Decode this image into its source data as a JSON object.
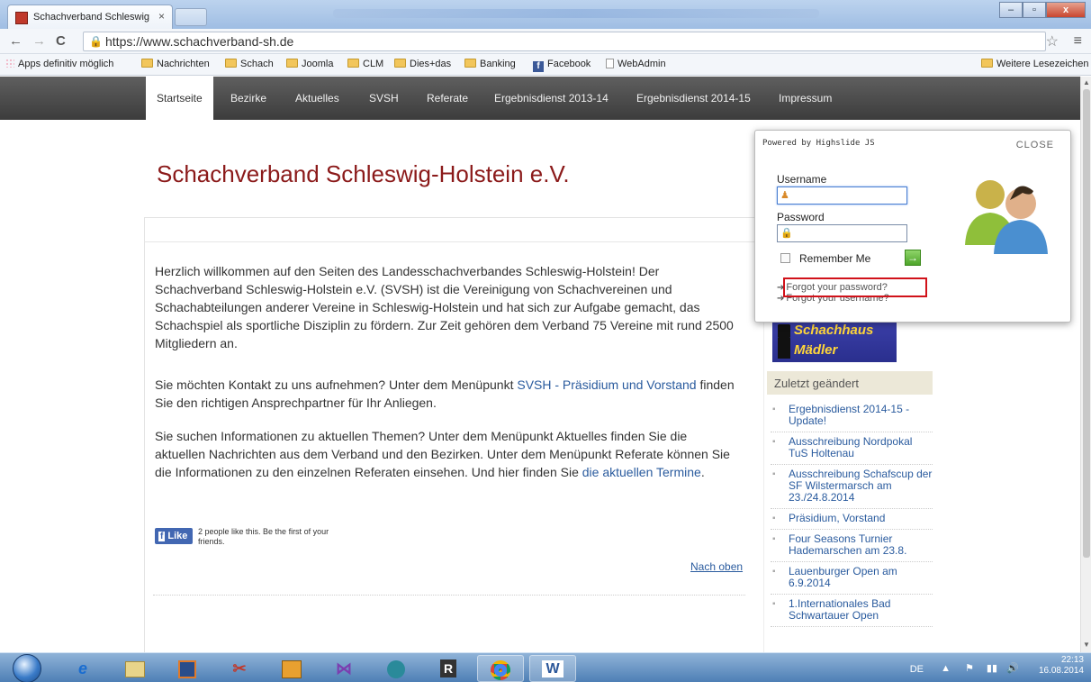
{
  "browser": {
    "tab_title": "Schachverband Schleswig",
    "tab_close": "×",
    "url": "https://www.schachverband-sh.de",
    "back": "←",
    "forward": "→",
    "reload": "C",
    "star": "☆",
    "menu": "≡"
  },
  "window": {
    "min": "–",
    "max": "▫",
    "close": "x"
  },
  "bookmarks": [
    {
      "label": "Apps definitiv möglich",
      "type": "apps"
    },
    {
      "label": "Nachrichten",
      "type": "folder"
    },
    {
      "label": "Schach",
      "type": "folder"
    },
    {
      "label": "Joomla",
      "type": "folder"
    },
    {
      "label": "CLM",
      "type": "folder"
    },
    {
      "label": "Dies+das",
      "type": "folder"
    },
    {
      "label": "Banking",
      "type": "folder"
    },
    {
      "label": "Facebook",
      "type": "facebook"
    },
    {
      "label": "WebAdmin",
      "type": "page"
    }
  ],
  "bookmarks_other": "Weitere Lesezeichen",
  "sitenav": [
    "Startseite",
    "Bezirke",
    "Aktuelles",
    "SVSH",
    "Referate",
    "Ergebnisdienst 2013-14",
    "Ergebnisdienst 2014-15",
    "Impressum"
  ],
  "site_title": "Schachverband Schleswig-Holstein e.V.",
  "paragraphs": {
    "p1": "Herzlich willkommen auf den Seiten des Landesschachverbandes Schleswig-Holstein! Der Schachverband Schleswig-Holstein e.V. (SVSH) ist die Vereinigung von Schachvereinen und Schachabteilungen anderer Vereine in Schleswig-Holstein und hat sich zur Aufgabe gemacht, das Schachspiel als sportliche Disziplin zu fördern. Zur Zeit gehören dem Verband 75 Vereine mit rund 2500 Mitgliedern an.",
    "p2_a": "Sie möchten Kontakt zu uns aufnehmen? Unter dem Menüpunkt ",
    "p2_link": "SVSH - Präsidium und Vorstand",
    "p2_b": " finden Sie den richtigen Ansprechpartner für Ihr Anliegen.",
    "p3_a": "Sie suchen Informationen zu aktuellen Themen? Unter dem Menüpunkt Aktuelles finden Sie die aktuellen Nachrichten aus dem Verband und den Bezirken. Unter dem Menüpunkt Referate können Sie die Informationen zu den einzelnen Referaten einsehen. Und hier finden Sie ",
    "p3_link": "die aktuellen Termine",
    "p3_b": "."
  },
  "like": {
    "button": "Like",
    "f": "f",
    "text": "2 people like this. Be the first of your friends."
  },
  "nach_oben": "Nach oben",
  "banner": {
    "line1": "Schachhaus",
    "line2": "Mädler"
  },
  "zuletzt_title": "Zuletzt geändert",
  "recent": [
    "Ergebnisdienst 2014-15 - Update!",
    "Ausschreibung Nordpokal TuS Holtenau",
    "Ausschreibung Schafscup der SF Wilstermarsch am 23./24.8.2014",
    "Präsidium, Vorstand",
    "Four Seasons Turnier Hademarschen am 23.8.",
    "Lauenburger Open am 6.9.2014",
    "1.Internationales Bad Schwartauer Open"
  ],
  "login": {
    "powered": "Powered by Highslide JS",
    "close": "CLOSE",
    "username_label": "Username",
    "username_value": "",
    "password_label": "Password",
    "password_value": "",
    "remember": "Remember Me",
    "go": "→",
    "forgot_password": "Forgot your password?",
    "forgot_username": "Forgot your username?"
  },
  "tray": {
    "lang": "DE",
    "time": "22:13",
    "date": "16.08.2014"
  },
  "taskbar_icons": [
    "ie",
    "explorer",
    "media",
    "snipping",
    "outlook",
    "visual-studio",
    "network",
    "r-app",
    "chrome",
    "word"
  ]
}
